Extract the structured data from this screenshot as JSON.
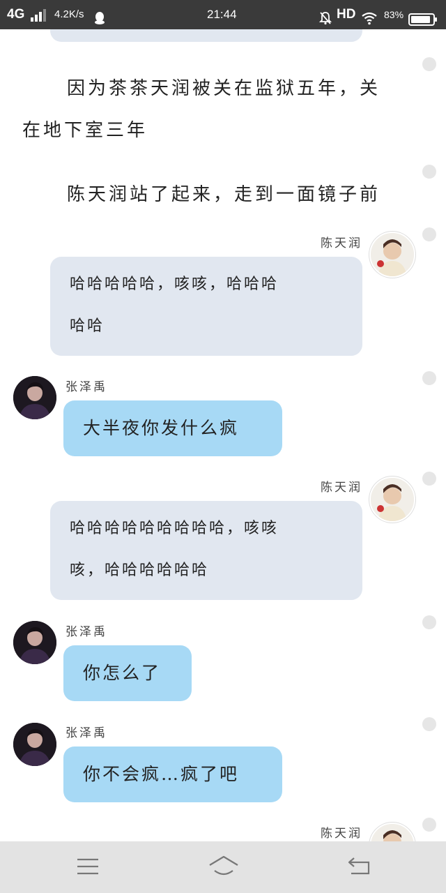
{
  "status_bar": {
    "network": "4G",
    "speed": "4.2K/s",
    "time": "21:44",
    "hd": "HD",
    "battery": "83%",
    "icons": [
      "signal-icon",
      "qq-icon",
      "bell-off-icon",
      "wifi-icon",
      "battery-icon"
    ]
  },
  "narration": [
    "因为茶茶天润被关在监狱五年，关",
    "在地下室三年",
    "陈天润站了起来，走到一面镜子前"
  ],
  "messages": [
    {
      "sender": "陈天润",
      "side": "right",
      "lines": [
        "哈哈哈哈哈，咳咳，哈哈哈",
        "哈哈"
      ]
    },
    {
      "sender": "张泽禹",
      "side": "left",
      "text": "大半夜你发什么疯"
    },
    {
      "sender": "陈天润",
      "side": "right",
      "lines": [
        "哈哈哈哈哈哈哈哈哈，咳咳",
        "咳，哈哈哈哈哈哈"
      ]
    },
    {
      "sender": "张泽禹",
      "side": "left",
      "text": "你怎么了"
    },
    {
      "sender": "张泽禹",
      "side": "left",
      "text": "你不会疯…疯了吧"
    },
    {
      "sender": "陈天润",
      "side": "right",
      "lines": []
    }
  ],
  "colors": {
    "status_bar": "#3a3a3a",
    "gray_bubble": "#e1e7f0",
    "blue_bubble": "#a7d9f5",
    "nav_bar": "#e3e3e3"
  },
  "nav_bar": {
    "icons": [
      "menu-icon",
      "home-icon",
      "back-icon"
    ]
  }
}
